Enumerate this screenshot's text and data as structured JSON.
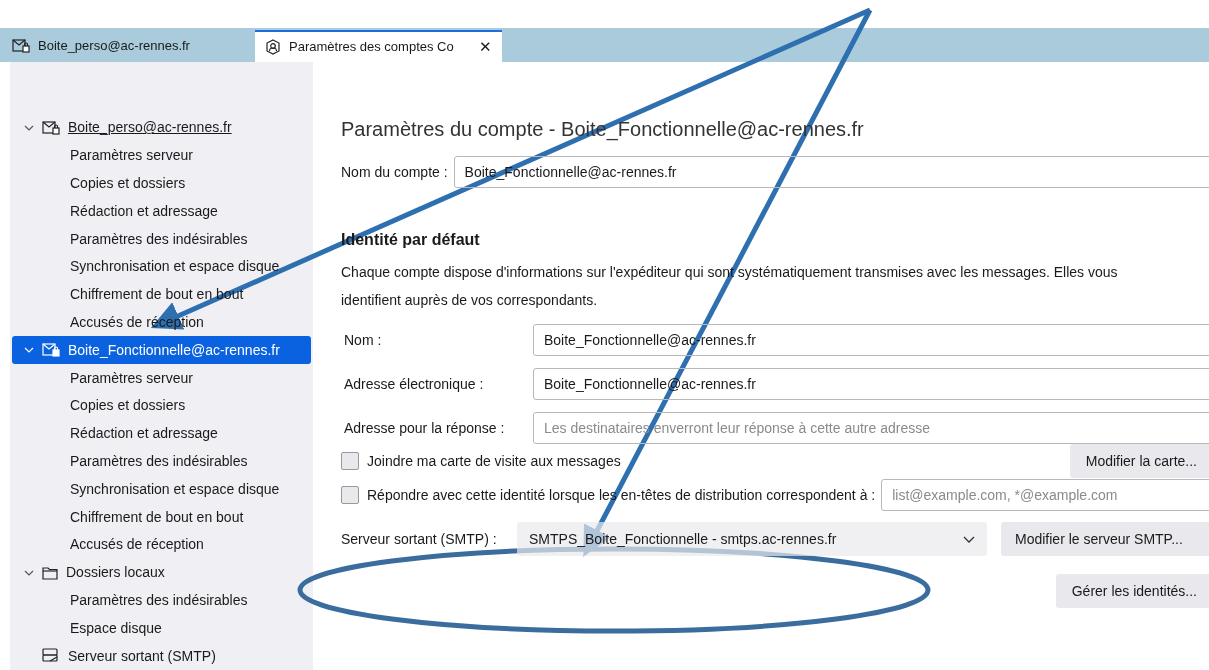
{
  "tabs": [
    {
      "label": "Boite_perso@ac-rennes.fr",
      "kind": "mail",
      "selected": false,
      "closable": false
    },
    {
      "label": "Paramètres des comptes Co",
      "kind": "account",
      "selected": true,
      "closable": true
    }
  ],
  "close_glyph": "✕",
  "sidebar": {
    "items": [
      {
        "label": "Boite_perso@ac-rennes.fr",
        "kind": "mail",
        "expanded": true,
        "selected": false,
        "underlined": true,
        "children": [
          {
            "label": "Paramètres serveur"
          },
          {
            "label": "Copies et dossiers"
          },
          {
            "label": "Rédaction et adressage"
          },
          {
            "label": "Paramètres des indésirables"
          },
          {
            "label": "Synchronisation et espace disque"
          },
          {
            "label": "Chiffrement de bout en bout"
          },
          {
            "label": "Accusés de réception"
          }
        ]
      },
      {
        "label": "Boite_Fonctionnelle@ac-rennes.fr",
        "kind": "mail",
        "expanded": true,
        "selected": true,
        "underlined": false,
        "children": [
          {
            "label": "Paramètres serveur"
          },
          {
            "label": "Copies et dossiers"
          },
          {
            "label": "Rédaction et adressage"
          },
          {
            "label": "Paramètres des indésirables"
          },
          {
            "label": "Synchronisation et espace disque"
          },
          {
            "label": "Chiffrement de bout en bout"
          },
          {
            "label": "Accusés de réception"
          }
        ]
      },
      {
        "label": "Dossiers locaux",
        "kind": "folder",
        "expanded": true,
        "selected": false,
        "underlined": false,
        "children": [
          {
            "label": "Paramètres des indésirables"
          },
          {
            "label": "Espace disque"
          }
        ]
      },
      {
        "label": "Serveur sortant (SMTP)",
        "kind": "server",
        "expanded": false,
        "selected": false,
        "underlined": false
      }
    ]
  },
  "main": {
    "title": "Paramètres du compte - Boite_Fonctionnelle@ac-rennes.fr",
    "account_name": {
      "label": "Nom du compte :",
      "value": "Boite_Fonctionnelle@ac-rennes.fr"
    },
    "identity_heading": "Identité par défaut",
    "identity_description": "Chaque compte dispose d'informations sur l'expéditeur qui sont systématiquement transmises avec les messages. Elles vous identifient auprès de vos correspondants.",
    "fields": [
      {
        "label": "Nom :",
        "value": "Boite_Fonctionnelle@ac-rennes.fr"
      },
      {
        "label": "Adresse électronique :",
        "value": "Boite_Fonctionnelle@ac-rennes.fr"
      },
      {
        "label": "Adresse pour la réponse :",
        "placeholder": "Les destinataires enverront leur réponse à cette autre adresse"
      }
    ],
    "options": [
      {
        "kind": "button",
        "label": "Joindre ma carte de visite aux messages",
        "checked": false,
        "button": "Modifier la carte..."
      },
      {
        "kind": "field",
        "label": "Répondre avec cette identité lorsque les en-têtes de distribution correspondent à :",
        "checked": false,
        "placeholder": "list@example.com, *@example.com"
      }
    ],
    "smtp": {
      "label": "Serveur sortant (SMTP) :",
      "value": "SMTPS_Boite_Fonctionnelle - smtps.ac-rennes.fr",
      "button": "Modifier le serveur SMTP..."
    },
    "manage_button": "Gérer les identités..."
  }
}
